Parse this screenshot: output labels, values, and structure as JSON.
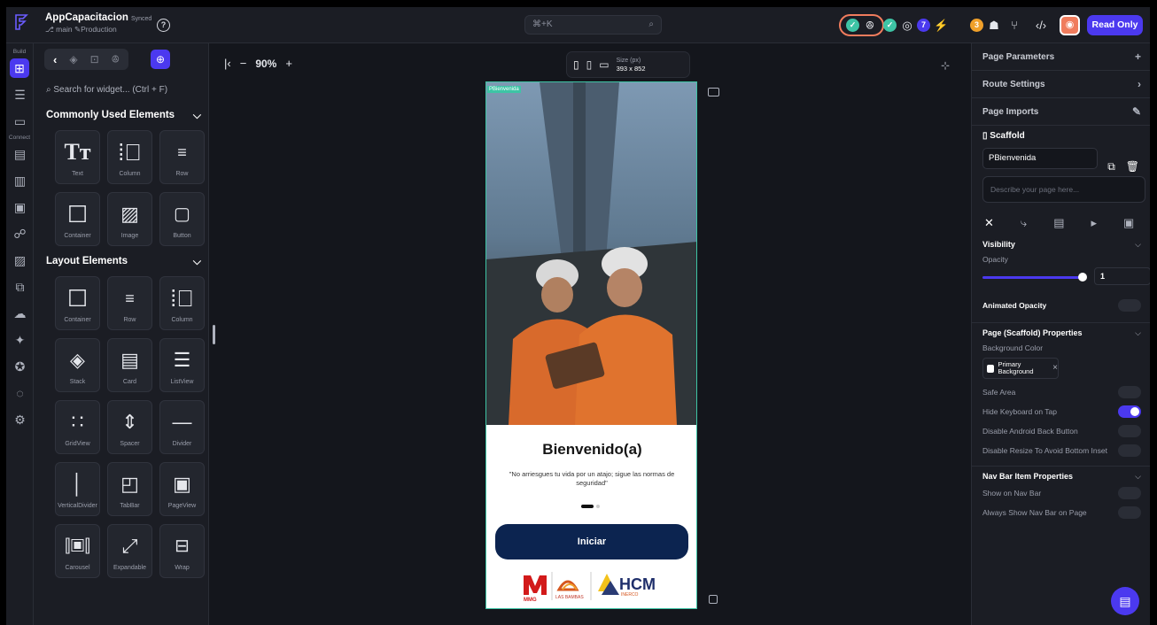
{
  "project": {
    "name": "AppCapacitacion",
    "status": "Synced",
    "branch": "main",
    "environment": "Production"
  },
  "search": {
    "shortcut": "⌘+K"
  },
  "header": {
    "read_only_label": "Read Only",
    "badge_counts": [
      "7",
      "3"
    ]
  },
  "rail": {
    "build_label": "Build",
    "connect_label": "Connect"
  },
  "widgets": {
    "search_placeholder": "Search for widget... (Ctrl + F)",
    "common_title": "Commonly Used Elements",
    "common": [
      {
        "label": "Text"
      },
      {
        "label": "Column"
      },
      {
        "label": "Row"
      },
      {
        "label": "Container"
      },
      {
        "label": "Image"
      },
      {
        "label": "Button"
      }
    ],
    "layout_title": "Layout Elements",
    "layout": [
      {
        "label": "Container"
      },
      {
        "label": "Row"
      },
      {
        "label": "Column"
      },
      {
        "label": "Stack"
      },
      {
        "label": "Card"
      },
      {
        "label": "ListView"
      },
      {
        "label": "GridView"
      },
      {
        "label": "Spacer"
      },
      {
        "label": "Divider"
      },
      {
        "label": "VerticalDivider"
      },
      {
        "label": "TabBar"
      },
      {
        "label": "PageView"
      },
      {
        "label": "Carousel"
      },
      {
        "label": "Expandable"
      },
      {
        "label": "Wrap"
      }
    ]
  },
  "canvas": {
    "zoom": "90%",
    "size_label": "Size (px)",
    "size_value": "393 x 852"
  },
  "phone": {
    "page_tag": "PBienvenida",
    "title": "Bienvenido(a)",
    "quote": "\"No arriesgues tu vida por un atajo; sigue las normas de seguridad\"",
    "button": "Iniciar",
    "logo_mmg": "MMG",
    "logo_lasbambas": "LAS BAMBAS",
    "logo_hcm": "HCM",
    "logo_hcm_sub": "INERCO"
  },
  "props": {
    "page_parameters": "Page Parameters",
    "route_settings": "Route Settings",
    "page_imports": "Page Imports",
    "scaffold": "Scaffold",
    "page_name": "PBienvenida",
    "description_placeholder": "Describe your page here...",
    "visibility": "Visibility",
    "opacity": "Opacity",
    "opacity_value": "1",
    "animated_opacity": "Animated Opacity",
    "scaffold_props": "Page (Scaffold) Properties",
    "background_color": "Background Color",
    "bg_chip": "Primary Background",
    "safe_area": "Safe Area",
    "hide_keyboard": "Hide Keyboard on Tap",
    "disable_back": "Disable Android Back Button",
    "disable_resize": "Disable Resize To Avoid Bottom Inset",
    "navbar_props": "Nav Bar Item Properties",
    "show_navbar": "Show on Nav Bar",
    "always_show": "Always Show Nav Bar on Page"
  },
  "colors": {
    "accent": "#4b39ef",
    "navy": "#0c2450",
    "teal": "#3ec4a5"
  }
}
